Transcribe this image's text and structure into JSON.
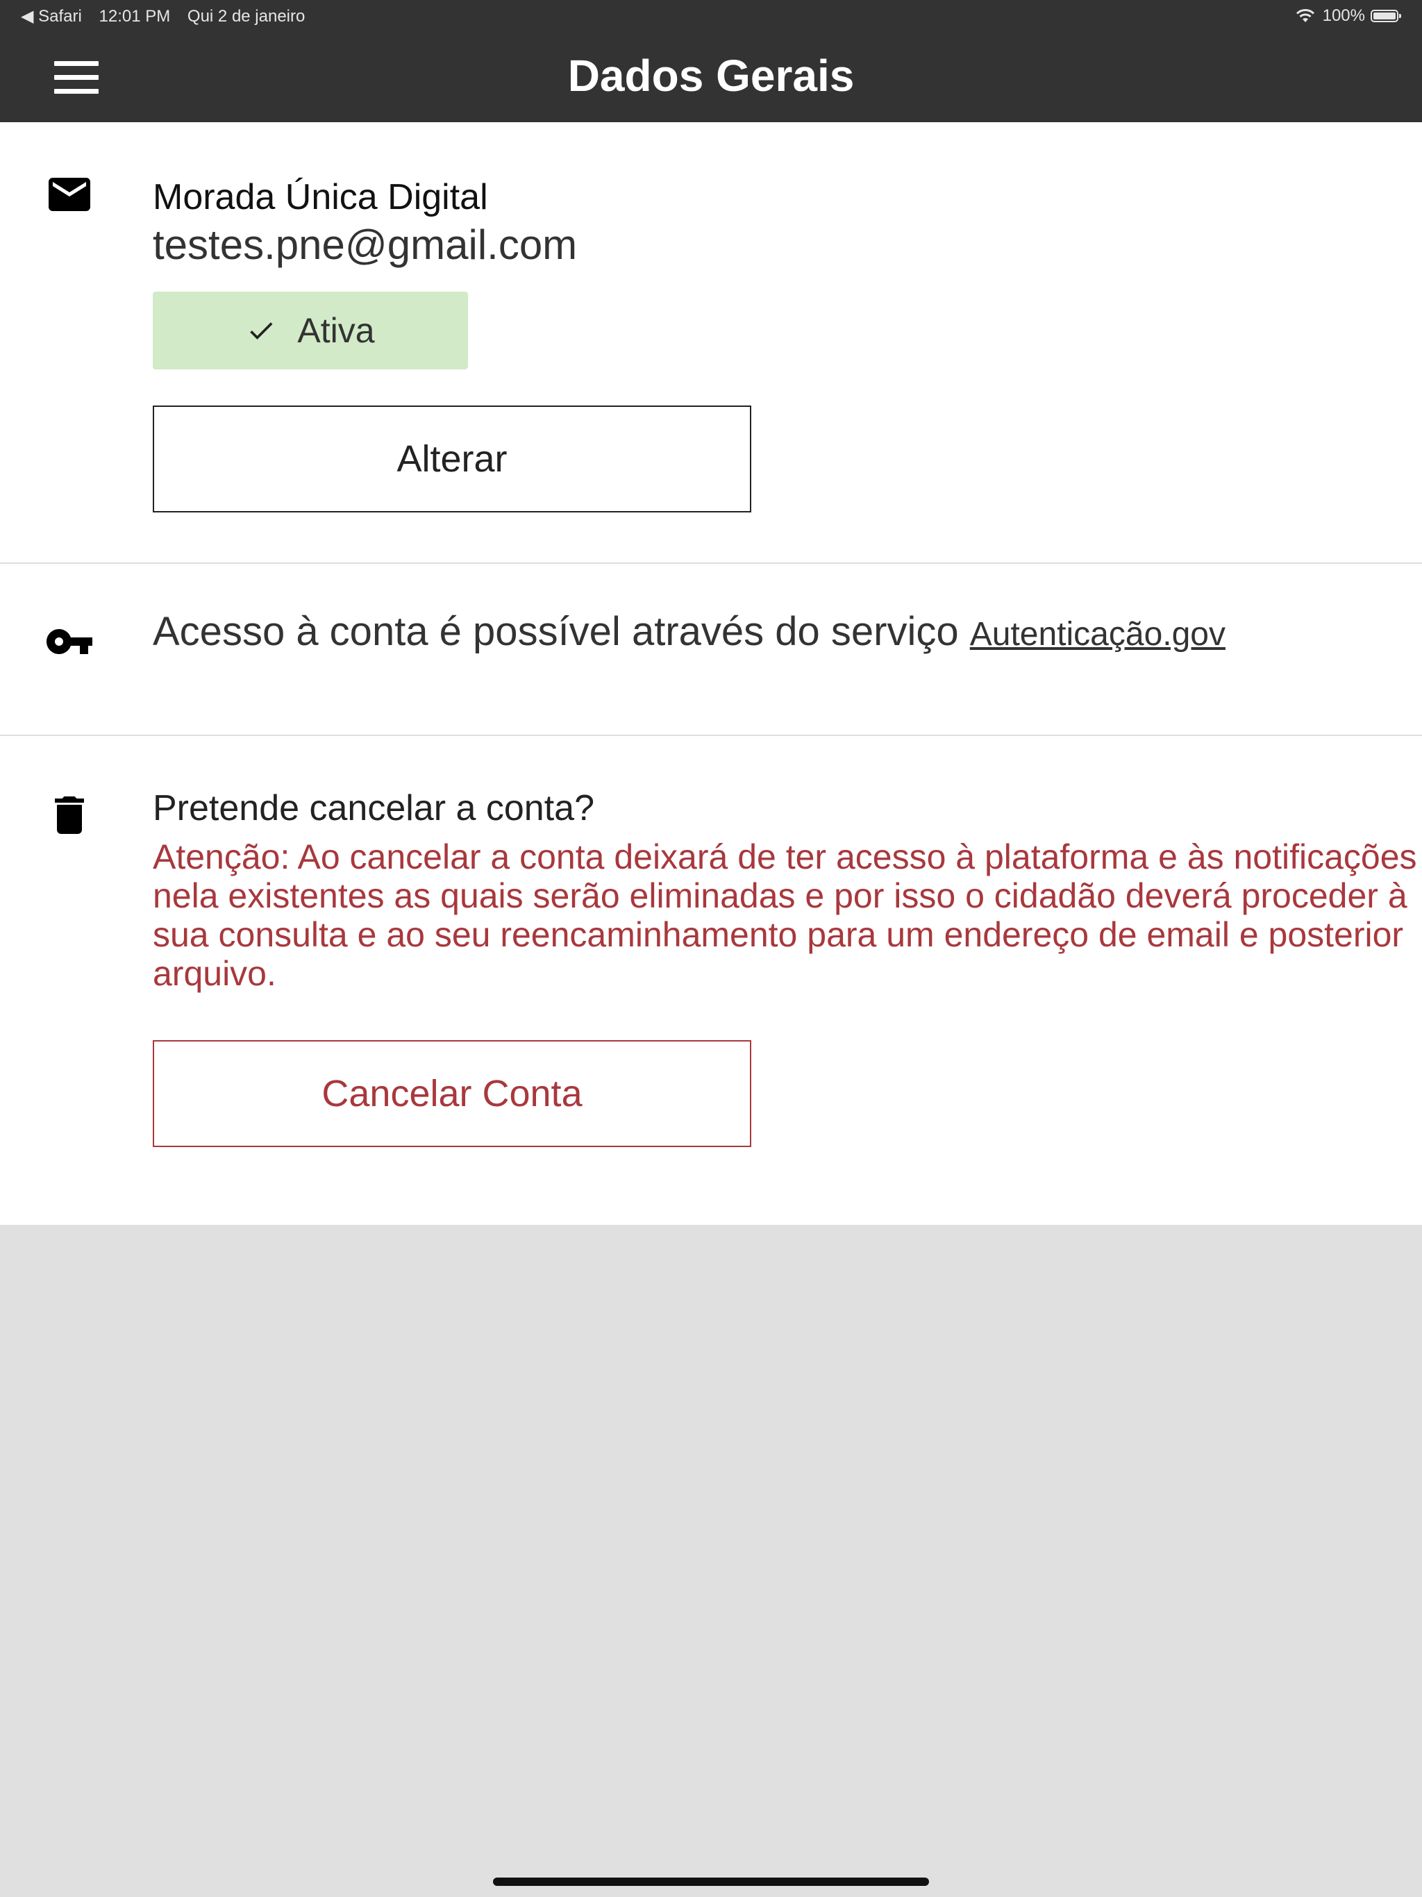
{
  "status_bar": {
    "back_app": "◀ Safari",
    "time": "12:01 PM",
    "date": "Qui 2 de janeiro",
    "battery": "100%"
  },
  "header": {
    "title": "Dados Gerais",
    "menu_icon": "hamburger-menu-icon"
  },
  "mud": {
    "icon": "email-icon",
    "title": "Morada Única Digital",
    "email": "testes.pne@gmail.com",
    "status_icon": "check-icon",
    "status_label": "Ativa",
    "status_color": "#d2eac8",
    "change_button": "Alterar"
  },
  "access": {
    "icon": "key-icon",
    "text": "Acesso à conta é possível através do serviço",
    "link": "Autenticação.gov"
  },
  "cancel": {
    "icon": "trash-icon",
    "question": "Pretende cancelar a conta?",
    "warning": "Atenção: Ao cancelar a conta deixará de ter acesso à plataforma e às notificações nela existentes as quais serão eliminadas e por isso o cidadão deverá proceder à sua consulta e ao seu reencaminhamento para um endereço de email e posterior arquivo.",
    "button": "Cancelar Conta",
    "accent_color": "#a8383d"
  },
  "colors": {
    "header_bg": "#333333",
    "page_bg": "#e0e0e0"
  }
}
